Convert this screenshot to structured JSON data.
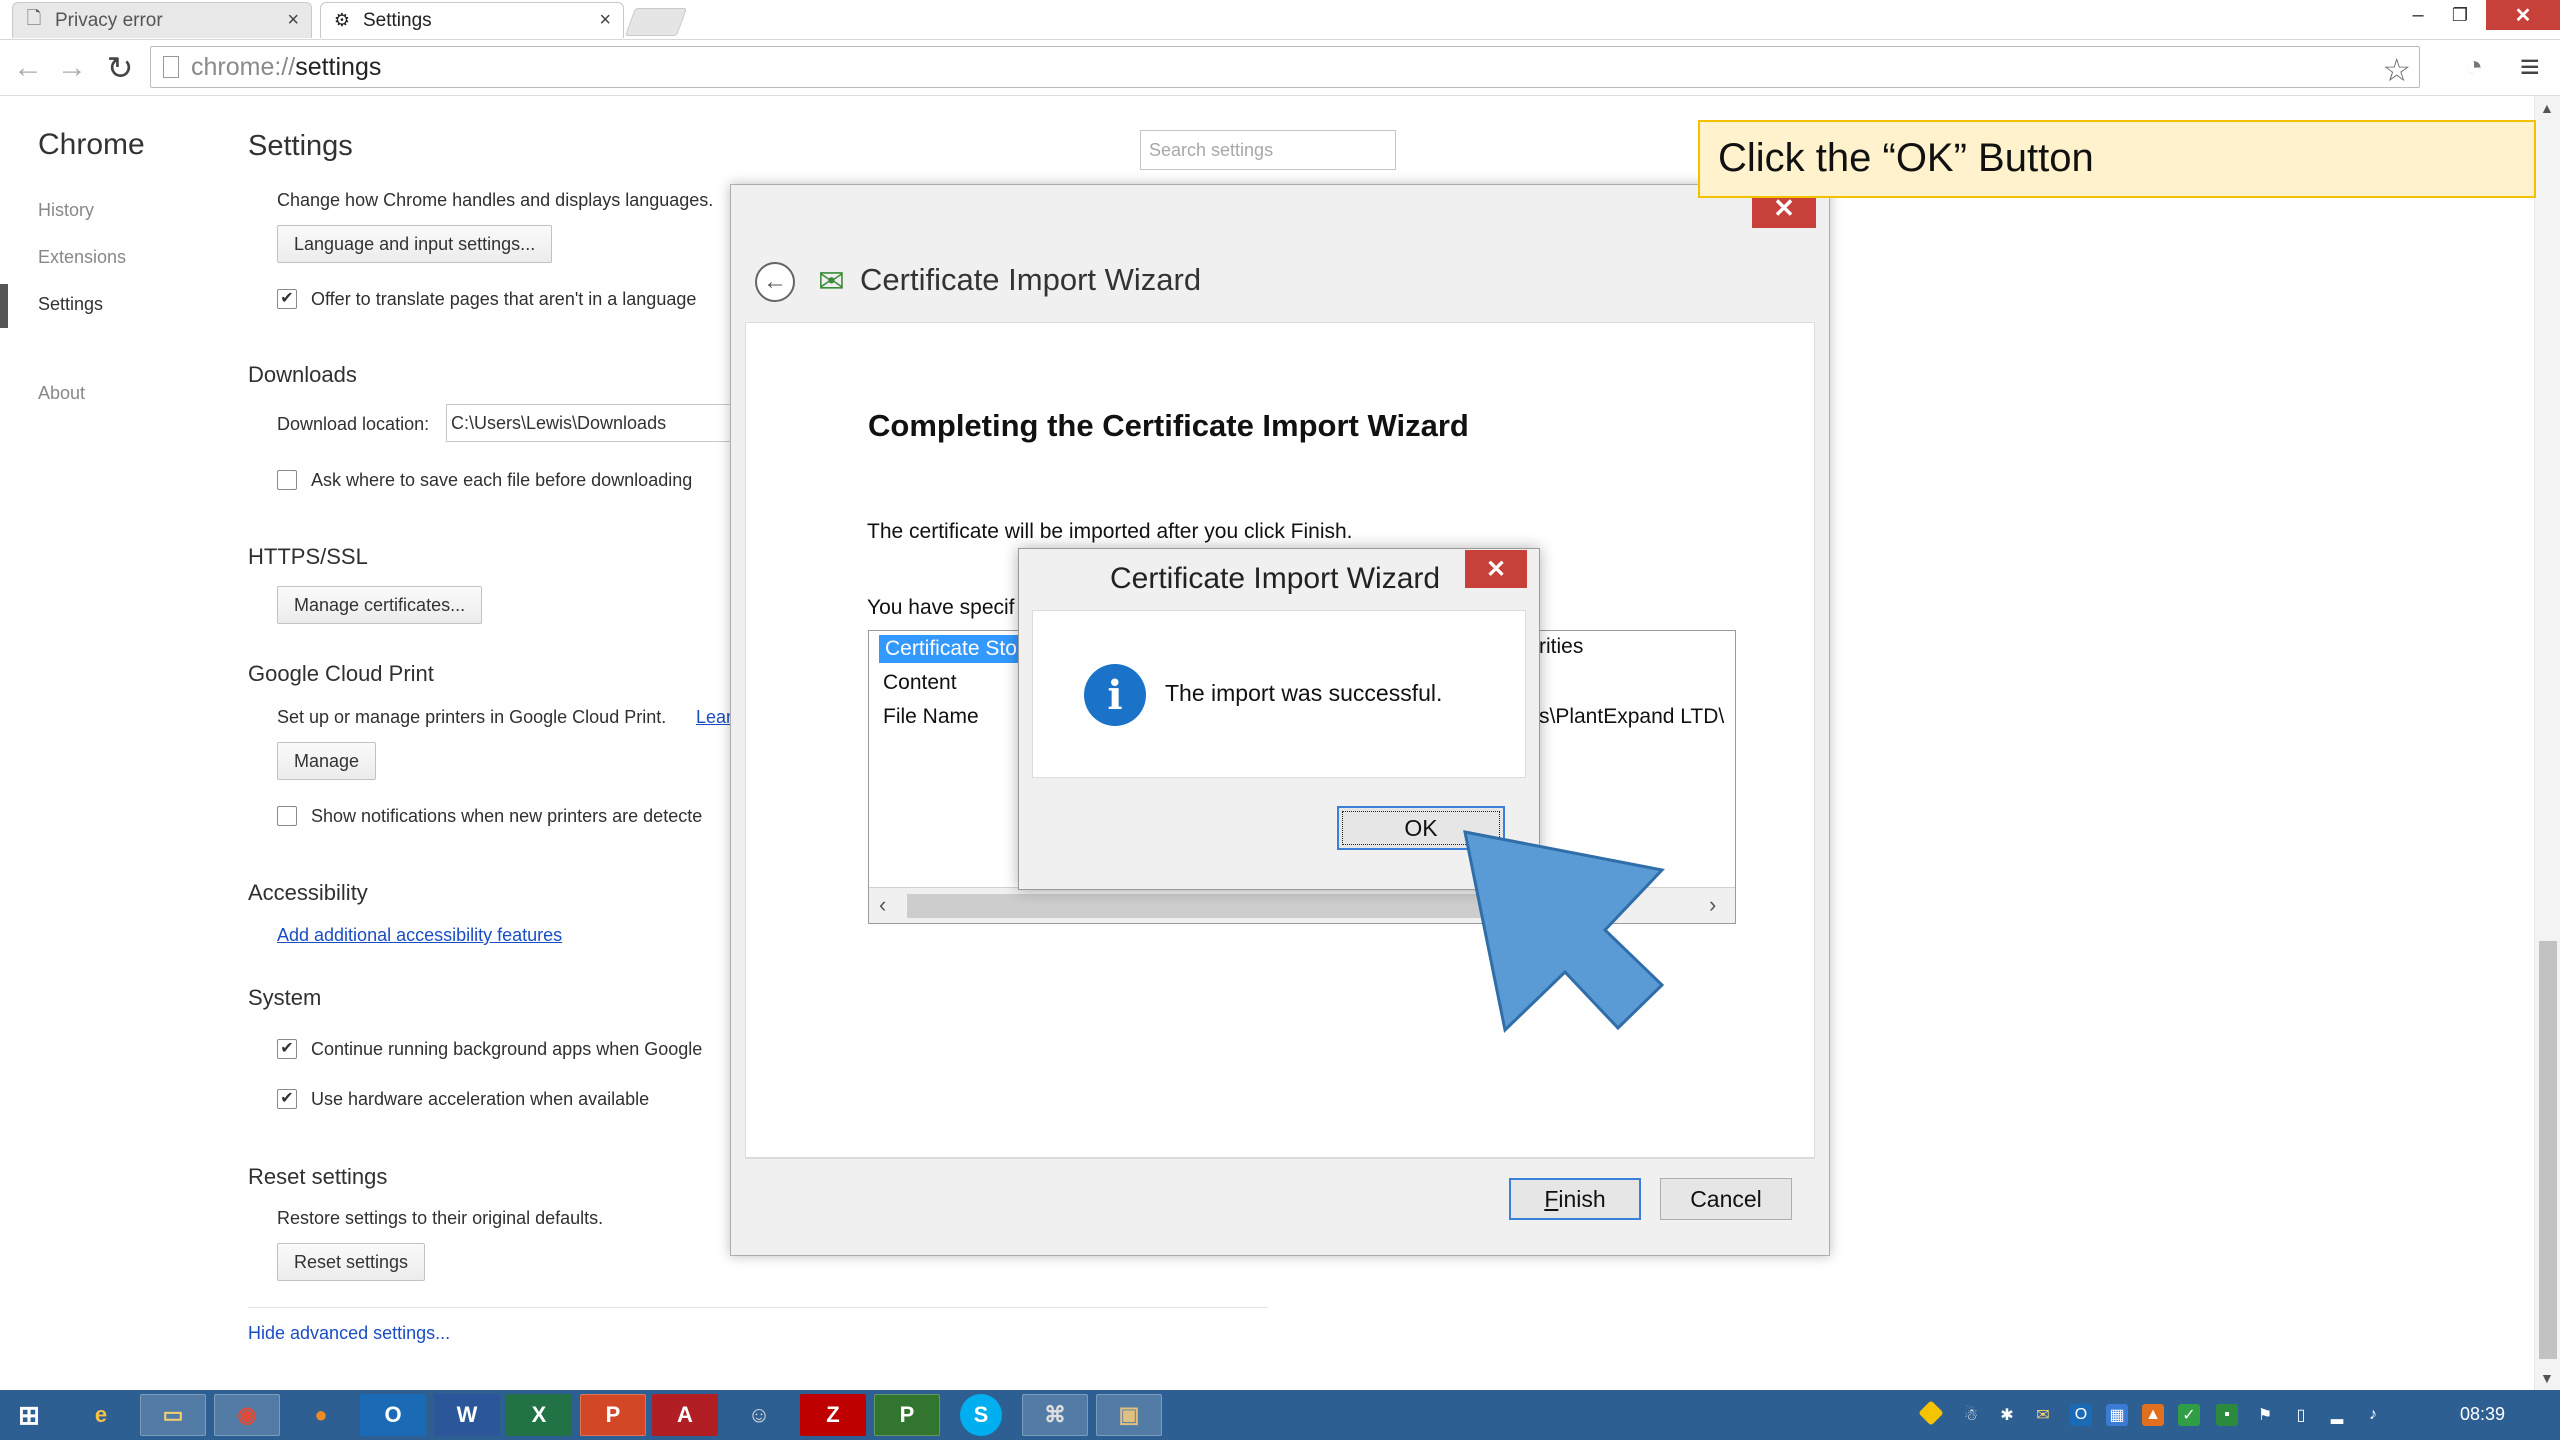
{
  "browser": {
    "tabs": [
      {
        "label": "Privacy error",
        "icon": "page-icon"
      },
      {
        "label": "Settings",
        "icon": "gear-icon"
      }
    ],
    "url_scheme": "chrome://",
    "url_path": "settings"
  },
  "sidebar": {
    "title": "Chrome",
    "items": [
      "History",
      "Extensions",
      "Settings",
      "About"
    ],
    "active": "Settings"
  },
  "settings": {
    "title": "Settings",
    "search_placeholder": "Search settings",
    "languages": {
      "desc": "Change how Chrome handles and displays languages.",
      "button": "Language and input settings...",
      "translate_label": "Offer to translate pages that aren't in a language",
      "translate_checked": true
    },
    "downloads": {
      "heading": "Downloads",
      "location_label": "Download location:",
      "location_value": "C:\\Users\\Lewis\\Downloads",
      "ask_label": "Ask where to save each file before downloading",
      "ask_checked": false
    },
    "https": {
      "heading": "HTTPS/SSL",
      "button": "Manage certificates..."
    },
    "cloud_print": {
      "heading": "Google Cloud Print",
      "desc": "Set up or manage printers in Google Cloud Print.",
      "link": "Lear",
      "button": "Manage",
      "notify_label": "Show notifications when new printers are detecte"
    },
    "accessibility": {
      "heading": "Accessibility",
      "link": "Add additional accessibility features"
    },
    "system": {
      "heading": "System",
      "background_label": "Continue running background apps when Google",
      "hardware_label": "Use hardware acceleration when available"
    },
    "reset": {
      "heading": "Reset settings",
      "desc": "Restore settings to their original defaults.",
      "button": "Reset settings"
    },
    "hide_advanced": "Hide advanced settings..."
  },
  "wizard": {
    "title": "Certificate Import Wizard",
    "heading": "Completing the Certificate Import Wizard",
    "description": "The certificate will be imported after you click Finish.",
    "specified": "You have specif",
    "list": [
      {
        "label": "Certificate Sto",
        "value": "rities"
      },
      {
        "label": "Content",
        "value": ""
      },
      {
        "label": "File Name",
        "value": "s\\PlantExpand LTD\\"
      }
    ],
    "finish_label": "Finish",
    "finish_mnemonic": "F",
    "cancel_label": "Cancel"
  },
  "msgbox": {
    "title": "Certificate Import Wizard",
    "message": "The import was successful.",
    "ok_label": "OK"
  },
  "callout": {
    "text": "Click the “OK” Button"
  },
  "taskbar": {
    "apps": [
      "start",
      "ie",
      "explorer",
      "chrome",
      "firefox",
      "outlook",
      "word",
      "excel",
      "powerpoint",
      "acrobat",
      "gimp",
      "filezilla",
      "project",
      "skype",
      "network",
      "media"
    ],
    "clock": "08:39"
  },
  "colors": {
    "accent_blue": "#3c7fd9",
    "close_red": "#c7403a",
    "callout_bg": "#fff2cc",
    "callout_border": "#f2c200",
    "arrow_blue": "#5b9bd5",
    "taskbar": "#2d5f93"
  }
}
